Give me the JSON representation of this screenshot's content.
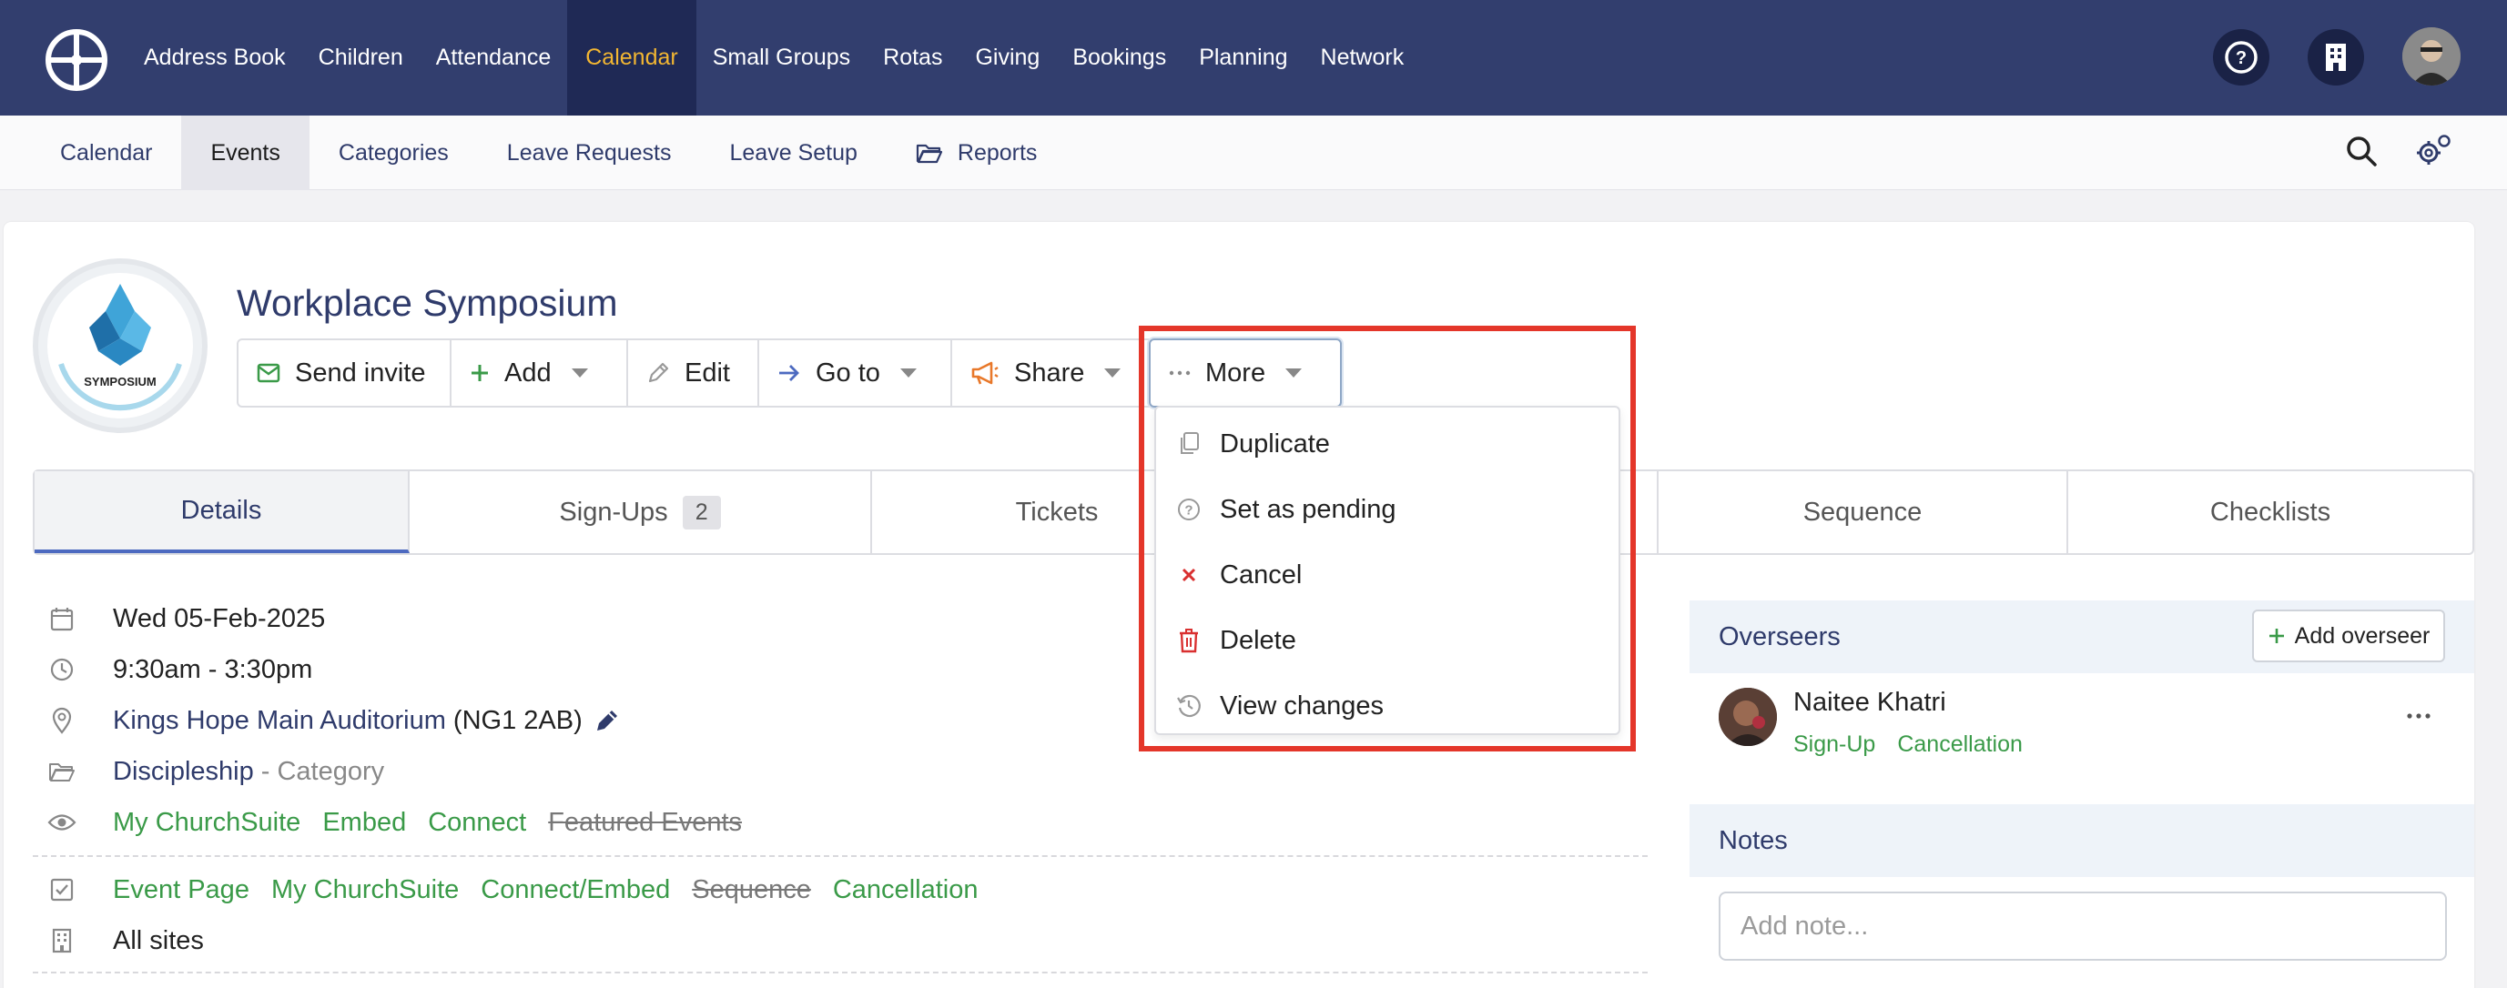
{
  "top_nav": {
    "logo_icon": "wheel-logo-icon",
    "items": [
      {
        "label": "Address Book"
      },
      {
        "label": "Children"
      },
      {
        "label": "Attendance"
      },
      {
        "label": "Calendar",
        "active": true
      },
      {
        "label": "Small Groups"
      },
      {
        "label": "Rotas"
      },
      {
        "label": "Giving"
      },
      {
        "label": "Bookings"
      },
      {
        "label": "Planning"
      },
      {
        "label": "Network"
      }
    ],
    "right_icons": [
      "help-icon",
      "building-icon",
      "user-avatar"
    ]
  },
  "sub_nav": {
    "items": [
      {
        "label": "Calendar"
      },
      {
        "label": "Events",
        "active": true
      },
      {
        "label": "Categories"
      },
      {
        "label": "Leave Requests"
      },
      {
        "label": "Leave Setup"
      },
      {
        "label": "Reports",
        "icon": "folder-open-icon"
      }
    ],
    "right_icons": [
      "search-icon",
      "settings-cogs-icon"
    ]
  },
  "event": {
    "title": "Workplace Symposium",
    "logo_text": "SYMPOSIUM"
  },
  "toolbar": {
    "send_invite": "Send invite",
    "add": "Add",
    "edit": "Edit",
    "go_to": "Go to",
    "share": "Share",
    "more": "More"
  },
  "more_menu": {
    "items": [
      {
        "label": "Duplicate",
        "icon": "copy-icon"
      },
      {
        "label": "Set as pending",
        "icon": "question-circle-icon"
      },
      {
        "label": "Cancel",
        "icon": "x-icon"
      },
      {
        "label": "Delete",
        "icon": "trash-icon"
      },
      {
        "label": "View changes",
        "icon": "history-icon"
      }
    ]
  },
  "tabs": [
    {
      "label": "Details",
      "active": true
    },
    {
      "label": "Sign-Ups",
      "badge": "2"
    },
    {
      "label": "Tickets"
    },
    {
      "label": ""
    },
    {
      "label": "Sequence"
    },
    {
      "label": "Checklists"
    }
  ],
  "details": {
    "date": "Wed 05-Feb-2025",
    "time": "9:30am - 3:30pm",
    "location_name": "Kings Hope Main Auditorium",
    "location_postcode": "(NG1 2AB)",
    "category": "Discipleship",
    "category_suffix": "- Category",
    "visibility": [
      "My ChurchSuite",
      "Embed",
      "Connect"
    ],
    "visibility_off": "Featured Events",
    "signup_options": [
      "Event Page",
      "My ChurchSuite",
      "Connect/Embed"
    ],
    "signup_off": "Sequence",
    "signup_last": "Cancellation",
    "sites": "All sites"
  },
  "overseers": {
    "heading": "Overseers",
    "add_button": "Add overseer",
    "person": {
      "name": "Naitee Khatri",
      "tags": [
        "Sign-Up",
        "Cancellation"
      ]
    }
  },
  "notes": {
    "heading": "Notes",
    "placeholder": "Add note..."
  },
  "colors": {
    "topbar": "#323e6e",
    "active_accent": "#f2b632",
    "green_link": "#3a9a48",
    "highlight_red": "#e4362a",
    "navy_text": "#2f3b6b"
  }
}
